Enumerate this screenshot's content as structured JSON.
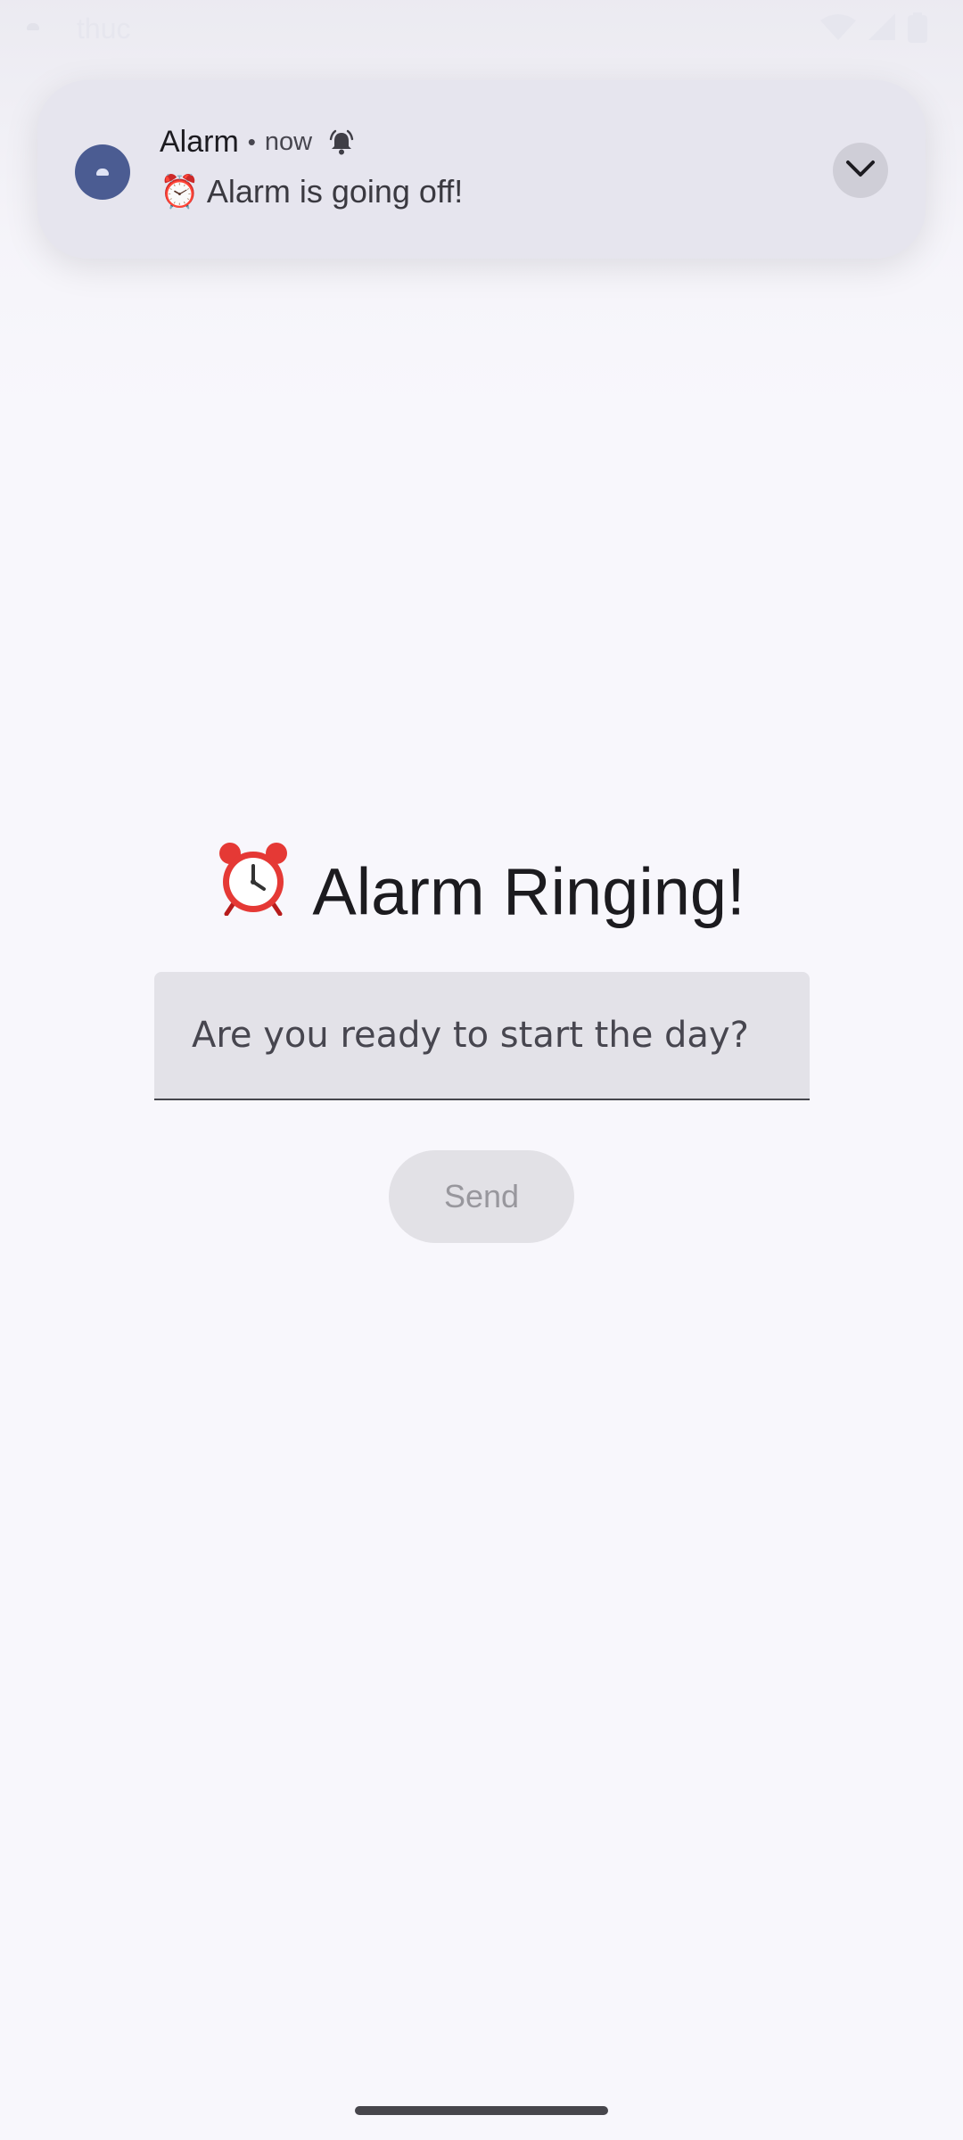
{
  "status_bar": {
    "time": "thuc",
    "icons": [
      "wifi-icon",
      "signal-icon",
      "battery-icon"
    ]
  },
  "notification": {
    "app_name": "Alarm",
    "separator": "•",
    "time": "now",
    "text": "⏰ Alarm is going off!",
    "icon": "alarm-bell-icon",
    "expand_icon": "chevron-down-icon"
  },
  "main": {
    "title_emoji": "⏰",
    "title": "Alarm Ringing!",
    "input": {
      "placeholder": "Are you ready to start the day?",
      "value": ""
    },
    "send_label": "Send"
  },
  "colors": {
    "background": "#f8f7fc",
    "notification_bg": "#e6e5ee",
    "app_icon": "#4b5c92",
    "button_disabled_bg": "#e2e1e6",
    "button_disabled_text": "#98979d"
  }
}
